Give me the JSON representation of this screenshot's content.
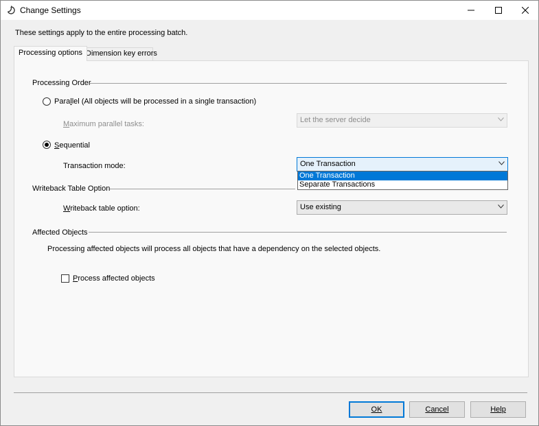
{
  "window": {
    "title": "Change Settings"
  },
  "intro_text": "These settings apply to the entire processing batch.",
  "tabs": [
    {
      "label": "Processing options",
      "active": true
    },
    {
      "label": "Dimension key errors",
      "active": false
    }
  ],
  "processing_order": {
    "heading": "Processing Order",
    "parallel": {
      "label_prefix": "Para",
      "label_mnemonic": "l",
      "label_suffix": "lel (All objects will be processed in a single transaction)",
      "selected": false
    },
    "max_parallel_tasks": {
      "label": "Maximum parallel tasks:",
      "value": "Let the server decide",
      "enabled": false
    },
    "sequential": {
      "label_mnemonic": "S",
      "label_suffix": "equential",
      "selected": true
    },
    "transaction_mode": {
      "label": "Transaction mode:",
      "value": "One Transaction",
      "options": [
        "One Transaction",
        "Separate Transactions"
      ],
      "open": true
    }
  },
  "writeback": {
    "heading": "Writeback Table Option",
    "label_mnemonic": "W",
    "label_suffix": "riteback table option:",
    "value": "Use existing"
  },
  "affected_objects": {
    "heading": "Affected Objects",
    "description": "Processing affected objects will process all objects that have a dependency on the selected objects.",
    "checkbox_mnemonic": "P",
    "checkbox_suffix": "rocess affected objects",
    "checked": false
  },
  "buttons": {
    "ok": "OK",
    "cancel": "Cancel",
    "help": "Help"
  },
  "colors": {
    "accent": "#0078d7",
    "disabled_text": "#8d8d8d"
  }
}
